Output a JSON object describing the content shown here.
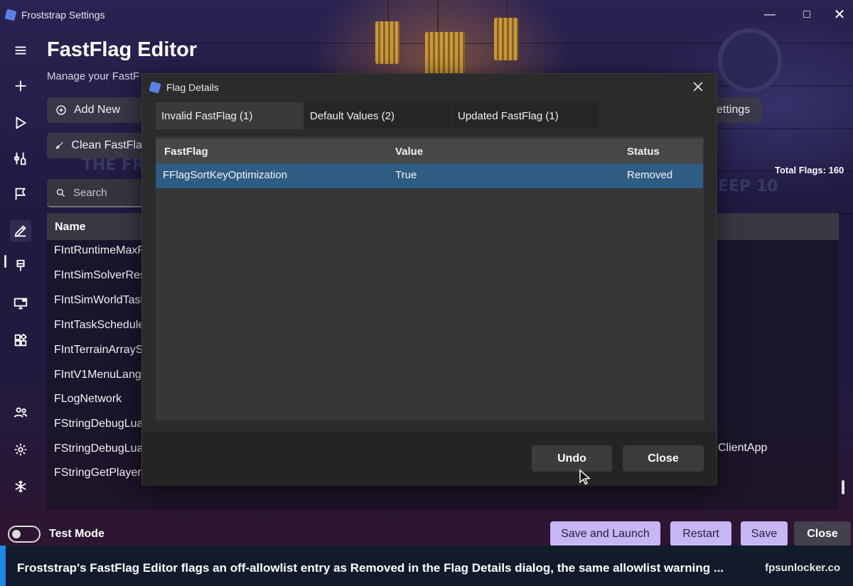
{
  "window": {
    "title": "Froststrap Settings",
    "controls": [
      "minimize",
      "maximize",
      "close"
    ]
  },
  "sidebar": {
    "items": [
      {
        "icon": "menu-icon",
        "active": false
      },
      {
        "icon": "plus-icon",
        "active": false
      },
      {
        "icon": "play-icon",
        "active": false
      },
      {
        "icon": "wrench-icon",
        "active": false
      },
      {
        "icon": "flag-icon",
        "active": false
      },
      {
        "icon": "edit-icon",
        "active": true
      },
      {
        "icon": "brush-icon",
        "active": false
      },
      {
        "icon": "monitor-icon",
        "active": false
      },
      {
        "icon": "apps-icon",
        "active": false
      },
      {
        "icon": "people-icon",
        "active": false
      },
      {
        "icon": "gear-icon",
        "active": false
      },
      {
        "icon": "snowflake-icon",
        "active": false
      }
    ]
  },
  "page": {
    "title": "FastFlag Editor",
    "subtitle": "Manage your FastF",
    "add_new_label": "Add New",
    "clean_label": "Clean FastFla",
    "settings_label": "ettings",
    "search_placeholder": "Search",
    "total_flags": "Total Flags: 160",
    "name_header": "Name",
    "flags": [
      "FIntRuntimeMaxP",
      "FIntSimSolverRes",
      "FIntSimWorldTask",
      "FIntTaskSchedule",
      "FIntTerrainArrayS",
      "FIntV1MenuLang",
      "FLogNetwork",
      "FStringDebugLua",
      "FStringDebugLua",
      "FStringGetPlayerI"
    ],
    "clientapp_text": "ClientApp"
  },
  "bottom_bar": {
    "test_mode_label": "Test Mode",
    "test_mode_on": false,
    "save_and_launch": "Save and Launch",
    "restart": "Restart",
    "save": "Save",
    "close": "Close"
  },
  "dialog": {
    "title": "Flag Details",
    "tabs": [
      {
        "label": "Invalid FastFlag (1)",
        "active": true
      },
      {
        "label": "Default Values (2)",
        "active": false
      },
      {
        "label": "Updated FastFlag (1)",
        "active": false
      }
    ],
    "columns": [
      "FastFlag",
      "Value",
      "Status"
    ],
    "rows": [
      {
        "fastflag": "FFlagSortKeyOptimization",
        "value": "True",
        "status": "Removed"
      }
    ],
    "undo_label": "Undo",
    "close_label": "Close"
  },
  "caption": {
    "text": "Froststrap's FastFlag Editor flags an off-allowlist entry as Removed in the Flag Details dialog, the same allowlist warning ...",
    "site": "fpsunlocker.co"
  },
  "colors": {
    "selected_row": "#2e5c84",
    "lavender_button": "#c6b6f4",
    "caption_accent": "#1e88e5",
    "caption_bg": "#111b2a"
  }
}
